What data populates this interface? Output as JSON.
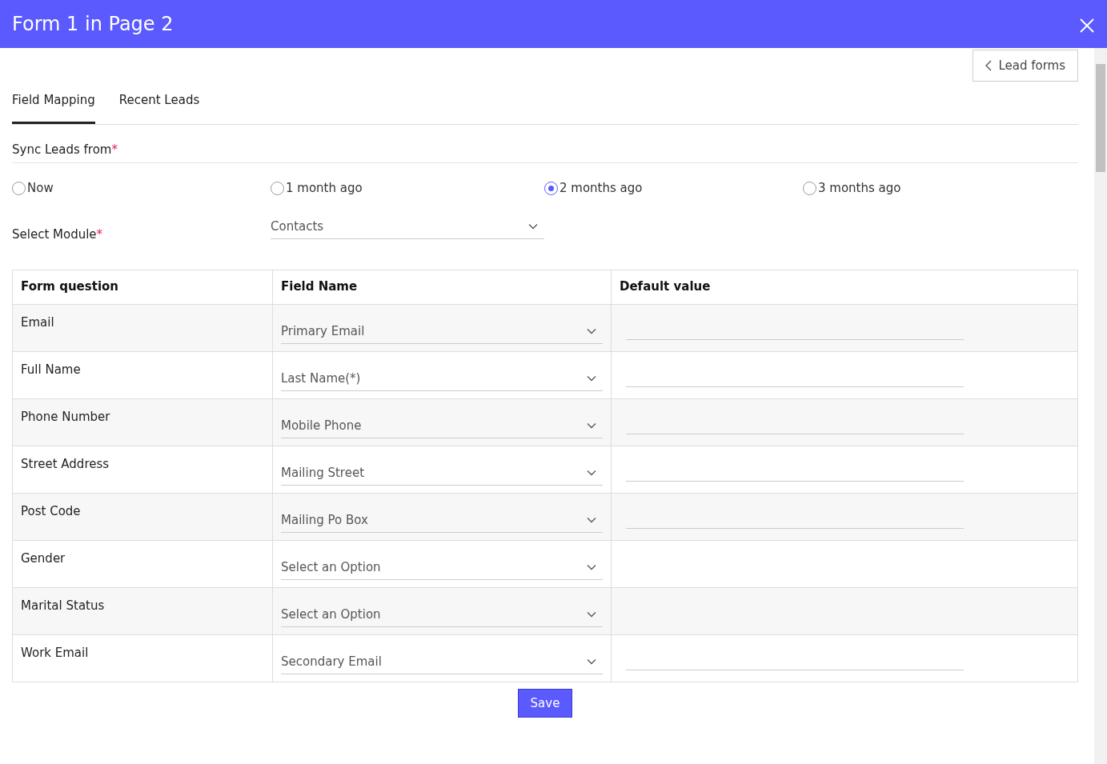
{
  "window": {
    "title": "Form 1 in Page 2"
  },
  "back_button": {
    "label": "Lead forms"
  },
  "tabs": [
    {
      "label": "Field Mapping",
      "selected": true
    },
    {
      "label": "Recent Leads",
      "selected": false
    }
  ],
  "sync": {
    "label": "Sync Leads from",
    "required_mark": "*",
    "options": [
      {
        "label": "Now",
        "selected": false
      },
      {
        "label": "1 month ago",
        "selected": false
      },
      {
        "label": "2 months ago",
        "selected": true
      },
      {
        "label": "3 months ago",
        "selected": false
      }
    ]
  },
  "module": {
    "label": "Select Module",
    "required_mark": "*",
    "value": "Contacts"
  },
  "table": {
    "columns": [
      "Form question",
      "Field Name",
      "Default value"
    ],
    "rows": [
      {
        "question": "Email",
        "field": "Primary Email",
        "default_field": true
      },
      {
        "question": "Full Name",
        "field": "Last Name(*)",
        "default_field": true
      },
      {
        "question": "Phone Number",
        "field": "Mobile Phone",
        "default_field": true
      },
      {
        "question": "Street Address",
        "field": "Mailing Street",
        "default_field": true
      },
      {
        "question": "Post Code",
        "field": "Mailing Po Box",
        "default_field": true
      },
      {
        "question": "Gender",
        "field": "Select an Option",
        "default_field": false
      },
      {
        "question": "Marital Status",
        "field": "Select an Option",
        "default_field": false
      },
      {
        "question": "Work Email",
        "field": "Secondary Email",
        "default_field": true
      }
    ]
  },
  "save_button": {
    "label": "Save"
  }
}
